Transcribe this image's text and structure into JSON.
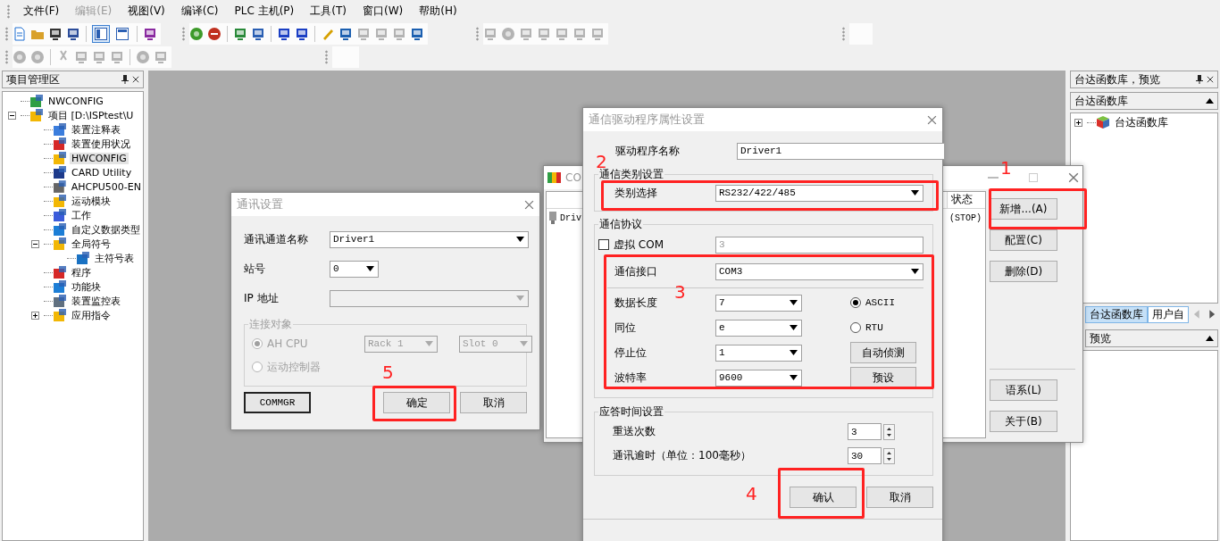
{
  "menu": [
    {
      "label": "文件(F)",
      "disabled": false
    },
    {
      "label": "编辑(E)",
      "disabled": true
    },
    {
      "label": "视图(V)",
      "disabled": false
    },
    {
      "label": "编译(C)",
      "disabled": false
    },
    {
      "label": "PLC 主机(P)",
      "disabled": false
    },
    {
      "label": "工具(T)",
      "disabled": false
    },
    {
      "label": "窗口(W)",
      "disabled": false
    },
    {
      "label": "帮助(H)",
      "disabled": false
    }
  ],
  "toolbar": {
    "layout_buttons": [
      {
        "selected": true
      },
      {
        "selected": false
      }
    ]
  },
  "project_panel": {
    "title": "项目管理区",
    "tree": [
      {
        "label": "NWCONFIG",
        "selected": false
      },
      {
        "label": "项目 [D:\\ISPtest\\U",
        "selected": false,
        "expanded": true,
        "children": [
          {
            "label": "装置注释表",
            "selected": false
          },
          {
            "label": "装置使用状况",
            "selected": false
          },
          {
            "label": "HWCONFIG",
            "selected": true
          },
          {
            "label": "CARD Utility",
            "selected": false
          },
          {
            "label": "AHCPU500-EN",
            "selected": false
          },
          {
            "label": "运动模块",
            "selected": false
          },
          {
            "label": "工作",
            "selected": false
          },
          {
            "label": "自定义数据类型",
            "selected": false
          },
          {
            "label": "全局符号",
            "selected": false,
            "expanded": true,
            "children": [
              {
                "label": "主符号表",
                "selected": false
              }
            ]
          },
          {
            "label": "程序",
            "selected": false
          },
          {
            "label": "功能块",
            "selected": false
          },
          {
            "label": "装置监控表",
            "selected": false
          },
          {
            "label": "应用指令",
            "selected": false,
            "expanded": false
          }
        ]
      }
    ]
  },
  "comm_settings": {
    "title": "通讯设置",
    "fields": [
      {
        "label": "通讯通道名称",
        "value": "Driver1",
        "kind": "wide",
        "disabled": false
      },
      {
        "label": "站号",
        "value": "0",
        "kind": "narrow",
        "disabled": false
      },
      {
        "label": "IP 地址",
        "kind": "wide",
        "disabled": true
      }
    ],
    "target_group": {
      "title": "连接对象",
      "disabled": true,
      "options": [
        {
          "label": "AH CPU",
          "selected": true
        },
        {
          "label": "运动控制器",
          "selected": false
        }
      ],
      "rack": "Rack 1",
      "slot": "Slot 0"
    },
    "buttons": [
      {
        "label": "COMMGR",
        "default": true
      },
      {
        "label": "确定",
        "default": false
      },
      {
        "label": "取消",
        "default": false
      }
    ]
  },
  "comm_manager": {
    "title": "CO",
    "status_header": "状态",
    "rows": [
      {
        "name": "Driv",
        "status": "(STOP)"
      }
    ],
    "buttons": [
      "新增...(A)",
      "配置(C)",
      "删除(D)"
    ],
    "lower_buttons": [
      "语系(L)",
      "关于(B)"
    ]
  },
  "driver_dialog": {
    "title": "通信驱动程序属性设置",
    "name_label": "驱动程序名称",
    "name_value": "Driver1",
    "type_group": {
      "title": "通信类别设置",
      "label": "类别选择",
      "value": "RS232/422/485"
    },
    "protocol_group": {
      "title": "通信协议",
      "virtual_com": {
        "label": "虚拟 COM",
        "checked": false,
        "value": "3",
        "disabled": true
      },
      "port": {
        "label": "通信接口",
        "value": "COM3"
      },
      "params": [
        {
          "label": "数据长度",
          "value": "7"
        },
        {
          "label": "同位",
          "value": "e"
        },
        {
          "label": "停止位",
          "value": "1"
        },
        {
          "label": "波特率",
          "value": "9600"
        }
      ],
      "modes": [
        {
          "label": "ASCII",
          "selected": true
        },
        {
          "label": "RTU",
          "selected": false
        }
      ],
      "buttons": [
        "自动侦测",
        "预设"
      ]
    },
    "timing_group": {
      "title": "应答时间设置",
      "rows": [
        {
          "label": "重送次数",
          "value": "3"
        },
        {
          "label": "通讯逾时（单位：100毫秒）",
          "value": "30"
        }
      ]
    },
    "buttons": [
      "确认",
      "取消"
    ]
  },
  "library_panel": {
    "title": "台达函数库，预览",
    "section": "台达函数库",
    "tree": [
      {
        "label": "台达函数库",
        "expanded": false
      }
    ],
    "tabs": [
      {
        "label": "台达函数库",
        "selected": true
      },
      {
        "label": "用户自",
        "selected": false
      }
    ],
    "preview_title": "预览"
  },
  "annotations": [
    {
      "label": "1"
    },
    {
      "label": "2"
    },
    {
      "label": "3"
    },
    {
      "label": "4"
    },
    {
      "label": "5"
    }
  ]
}
